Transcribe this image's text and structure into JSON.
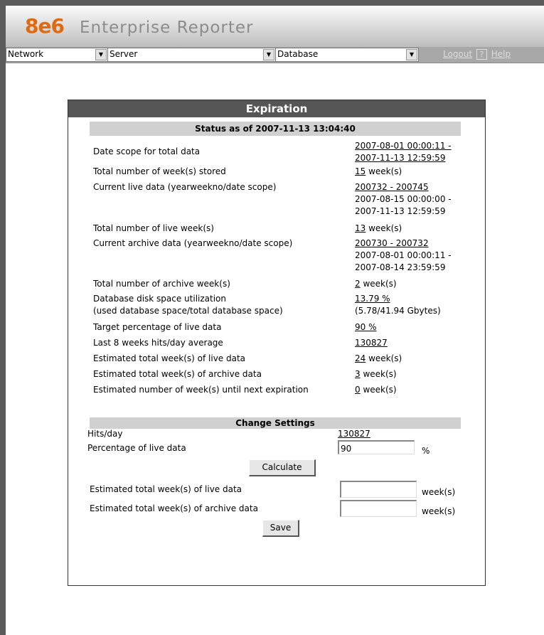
{
  "app": {
    "logo": "8e6",
    "product": "Enterprise Reporter"
  },
  "menu": {
    "network_label": "Network",
    "server_label": "Server",
    "database_label": "Database",
    "logout_label": "Logout",
    "help_icon_text": "?",
    "help_label": "Help"
  },
  "panel": {
    "title": "Expiration",
    "status_header": "Status as of 2007-11-13 13:04:40",
    "rows": [
      {
        "label": "Date scope for total data",
        "link": "2007-08-01 00:00:11 -",
        "link2": "2007-11-13 12:59:59"
      },
      {
        "label": "Total number of week(s) stored",
        "link": "15",
        "suffix": " week(s)"
      },
      {
        "label": "Current live data (yearweekno/date scope)",
        "link": "200732 - 200745",
        "line2": "2007-08-15 00:00:00 -",
        "line3": "2007-11-13 12:59:59"
      },
      {
        "label": "Total number of live week(s)",
        "link": "13",
        "suffix": " week(s)"
      },
      {
        "label": "Current archive data (yearweekno/date scope)",
        "link": "200730 - 200732",
        "line2": "2007-08-01 00:00:11 -",
        "line3": "2007-08-14 23:59:59"
      },
      {
        "label": "Total number of archive week(s)",
        "link": "2",
        "suffix": " week(s)"
      },
      {
        "label": "Database disk space utilization",
        "label2": "(used database space/total database space)",
        "link": "13.79 %",
        "line2": "(5.78/41.94 Gbytes)"
      },
      {
        "label": "Target percentage of live data",
        "link": "90 %"
      },
      {
        "label": "Last 8 weeks hits/day average",
        "link": "130827"
      },
      {
        "label": "Estimated total week(s) of live data",
        "link": "24",
        "suffix": " week(s)"
      },
      {
        "label": "Estimated total week(s) of archive data",
        "link": "3",
        "suffix": " week(s)"
      },
      {
        "label": "Estimated number of week(s) until next expiration",
        "link": "0",
        "suffix": " week(s)"
      }
    ],
    "change_settings": {
      "header": "Change Settings",
      "hits_label": "Hits/day",
      "hits_value": "130827",
      "pct_label": "Percentage of live data",
      "pct_value": "90",
      "pct_unit": "%",
      "calculate_label": "Calculate",
      "live_weeks_label": "Estimated total week(s) of live data",
      "live_weeks_value": "",
      "archive_weeks_label": "Estimated total week(s) of archive data",
      "archive_weeks_value": "",
      "weeks_unit": "week(s)",
      "save_label": "Save"
    }
  }
}
